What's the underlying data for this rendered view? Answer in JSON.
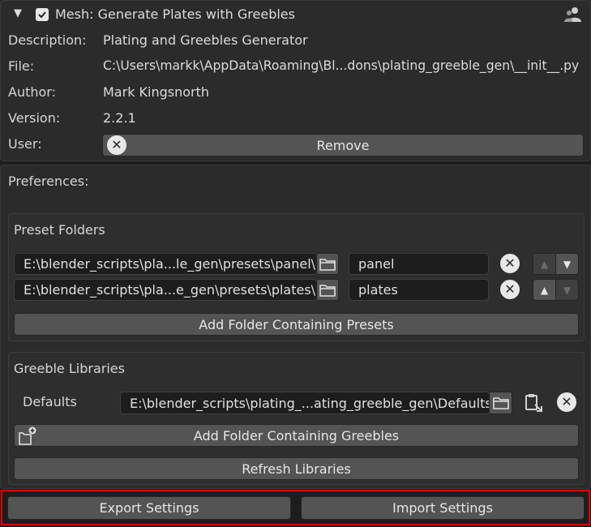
{
  "addon": {
    "title": "Mesh: Generate Plates with Greebles",
    "enabled": true,
    "description_label": "Description:",
    "description": "Plating and Greebles Generator",
    "file_label": "File:",
    "file": "C:\\Users\\markk\\AppData\\Roaming\\Bl...dons\\plating_greeble_gen\\__init__.py",
    "author_label": "Author:",
    "author": "Mark Kingsnorth",
    "version_label": "Version:",
    "version": "2.2.1",
    "user_label": "User:",
    "remove_label": "Remove"
  },
  "preferences": {
    "heading": "Preferences:",
    "preset_folders": {
      "heading": "Preset Folders",
      "items": [
        {
          "path": "E:\\blender_scripts\\pla...le_gen\\presets\\panel\\",
          "name": "panel"
        },
        {
          "path": "E:\\blender_scripts\\pla...e_gen\\presets\\plates\\",
          "name": "plates"
        }
      ],
      "add_label": "Add Folder Containing Presets"
    },
    "greeble_libraries": {
      "heading": "Greeble Libraries",
      "items": [
        {
          "name": "Defaults",
          "path": "E:\\blender_scripts\\plating_...ating_greeble_gen\\Defaults"
        }
      ],
      "add_label": "Add Folder Containing Greebles",
      "refresh_label": "Refresh Libraries"
    },
    "export_label": "Export Settings",
    "import_label": "Import Settings"
  },
  "colors": {
    "highlight_border": "#e00000",
    "button": "#545454",
    "field": "#1d1d1d"
  }
}
